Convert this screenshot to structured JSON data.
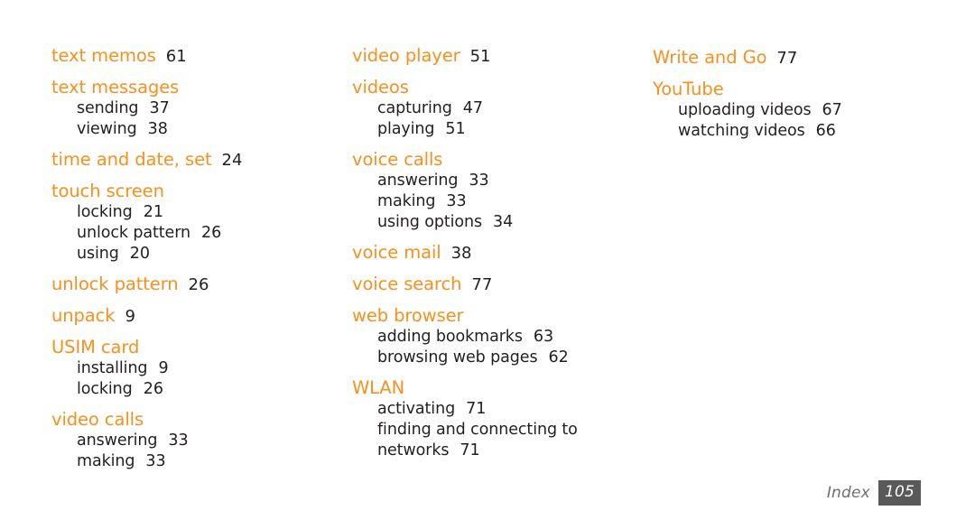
{
  "document": {
    "section_label": "Index",
    "page_number": "105",
    "heading_color": "#F7901E",
    "text_color": "#231F20",
    "footer_box_color": "#595959",
    "footer_label_color": "#6D6E71"
  },
  "columns": [
    {
      "entries": [
        {
          "label": "text memos",
          "page": "61",
          "subentries": []
        },
        {
          "label": "text messages",
          "page": "",
          "subentries": [
            {
              "label": "sending",
              "page": "37"
            },
            {
              "label": "viewing",
              "page": "38"
            }
          ]
        },
        {
          "label": "time and date, set",
          "page": "24",
          "subentries": []
        },
        {
          "label": "touch screen",
          "page": "",
          "subentries": [
            {
              "label": "locking",
              "page": "21"
            },
            {
              "label": "unlock pattern",
              "page": "26"
            },
            {
              "label": "using",
              "page": "20"
            }
          ]
        },
        {
          "label": "unlock pattern",
          "page": "26",
          "subentries": []
        },
        {
          "label": "unpack",
          "page": "9",
          "subentries": []
        },
        {
          "label": "USIM card",
          "page": "",
          "subentries": [
            {
              "label": "installing",
              "page": "9"
            },
            {
              "label": "locking",
              "page": "26"
            }
          ]
        },
        {
          "label": "video calls",
          "page": "",
          "subentries": [
            {
              "label": "answering",
              "page": "33"
            },
            {
              "label": "making",
              "page": "33"
            }
          ]
        }
      ]
    },
    {
      "entries": [
        {
          "label": "video player",
          "page": "51",
          "subentries": []
        },
        {
          "label": "videos",
          "page": "",
          "subentries": [
            {
              "label": "capturing",
              "page": "47"
            },
            {
              "label": "playing",
              "page": "51"
            }
          ]
        },
        {
          "label": "voice calls",
          "page": "",
          "subentries": [
            {
              "label": "answering",
              "page": "33"
            },
            {
              "label": "making",
              "page": "33"
            },
            {
              "label": "using options",
              "page": "34"
            }
          ]
        },
        {
          "label": "voice mail",
          "page": "38",
          "subentries": []
        },
        {
          "label": "voice search",
          "page": "77",
          "subentries": []
        },
        {
          "label": "web browser",
          "page": "",
          "subentries": [
            {
              "label": "adding bookmarks",
              "page": "63"
            },
            {
              "label": "browsing web pages",
              "page": "62"
            }
          ]
        },
        {
          "label": "WLAN",
          "page": "",
          "subentries": [
            {
              "label": "activating",
              "page": "71"
            },
            {
              "label": "finding and connecting to networks",
              "page": "71",
              "wraps": true
            }
          ]
        }
      ]
    },
    {
      "entries": [
        {
          "label": "Write and Go",
          "page": "77",
          "subentries": []
        },
        {
          "label": "YouTube",
          "page": "",
          "subentries": [
            {
              "label": "uploading videos",
              "page": "67"
            },
            {
              "label": "watching videos",
              "page": "66"
            }
          ]
        }
      ]
    }
  ]
}
